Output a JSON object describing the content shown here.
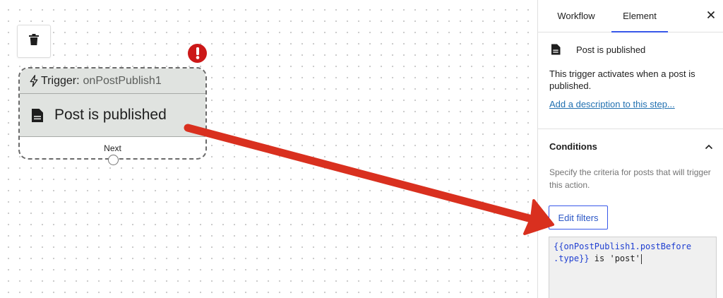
{
  "node": {
    "trigger_prefix": "Trigger:",
    "trigger_name": "onPostPublish1",
    "title": "Post is published",
    "next_label": "Next",
    "error_mark": "!"
  },
  "panel": {
    "tabs": [
      {
        "label": "Workflow",
        "active": false
      },
      {
        "label": "Element",
        "active": true
      }
    ],
    "close_symbol": "✕",
    "step_title": "Post is published",
    "step_description": "This trigger activates when a post is published.",
    "add_description_link": "Add a description to this step...",
    "conditions": {
      "title": "Conditions",
      "description": "Specify the criteria for posts that will trigger this action.",
      "edit_filters_label": "Edit filters",
      "code_line1": "{{onPostPublish1.postBefore",
      "code_line2_token": ".type}}",
      "code_line2_rest": " is 'post'"
    }
  },
  "colors": {
    "error": "#cc1818",
    "accent": "#3858e9",
    "link": "#2271b1",
    "annotation_arrow": "#d9301f",
    "node_fill": "#e0e3e0"
  },
  "icons": {
    "trash": "trash-icon",
    "error": "error-icon",
    "bolt": "bolt-icon",
    "document": "document-icon",
    "close": "close-icon",
    "collapse": "chevron-up-icon"
  }
}
